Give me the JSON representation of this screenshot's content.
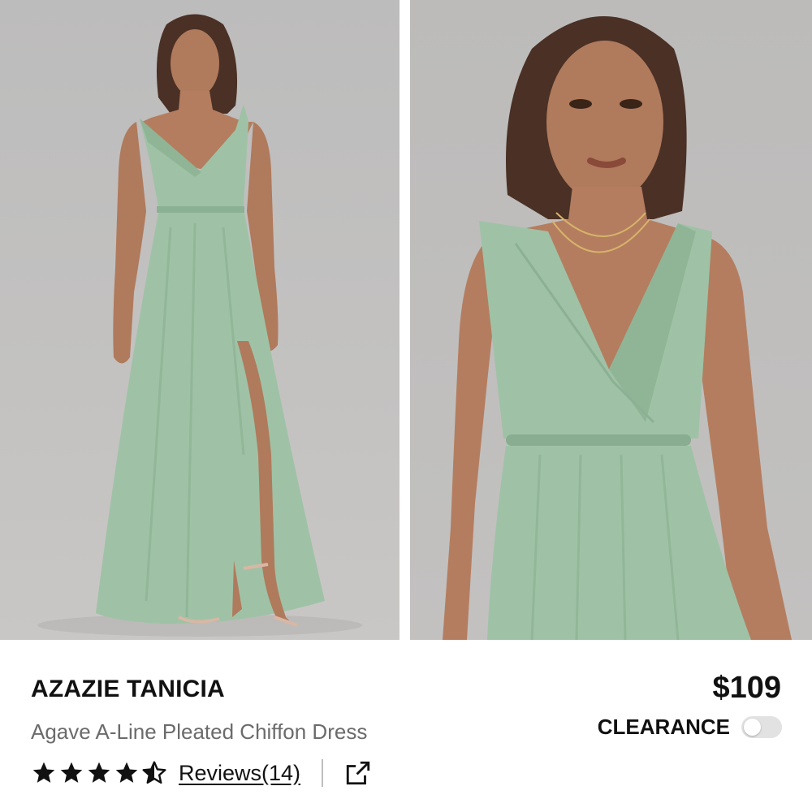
{
  "product": {
    "brand": "AZAZIE TANICIA",
    "name": "Agave A-Line Pleated Chiffon Dress",
    "price": "$109",
    "clearance_label": "CLEARANCE",
    "clearance_on": false,
    "rating": 4.5,
    "reviews_label": "Reviews(14)"
  },
  "colors": {
    "dress": "#9fc2a6",
    "background": "#c0bfbe",
    "text": "#111111",
    "subtext": "#6b6b6b",
    "toggle_off": "#e2e2e2"
  },
  "icons": {
    "stars": "star-icon",
    "share": "external-link-icon"
  }
}
